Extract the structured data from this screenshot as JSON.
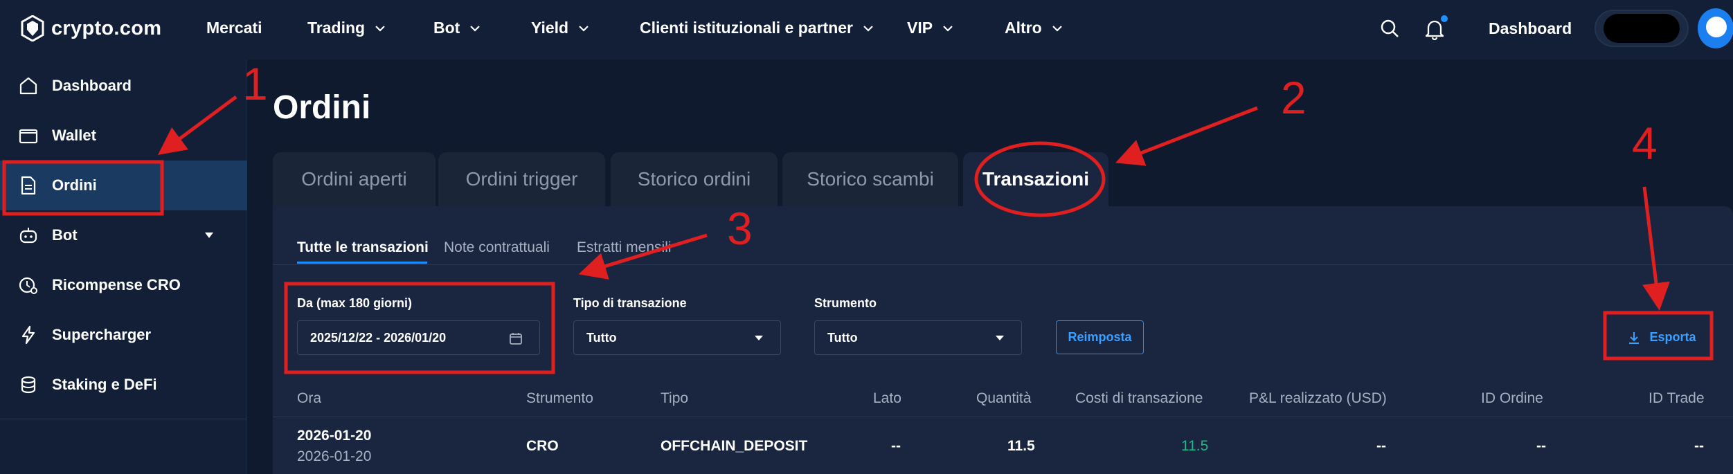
{
  "brand": {
    "name": "crypto.com"
  },
  "topnav": {
    "items": [
      {
        "label": "Mercati",
        "has_dropdown": false
      },
      {
        "label": "Trading",
        "has_dropdown": true
      },
      {
        "label": "Bot",
        "has_dropdown": true
      },
      {
        "label": "Yield",
        "has_dropdown": true
      },
      {
        "label": "Clienti istituzionali e partner",
        "has_dropdown": true
      },
      {
        "label": "VIP",
        "has_dropdown": true
      },
      {
        "label": "Altro",
        "has_dropdown": true
      }
    ],
    "icons": [
      "search-icon",
      "bell-icon"
    ],
    "dashboard_label": "Dashboard"
  },
  "sidebar": {
    "items": [
      {
        "label": "Dashboard",
        "icon": "home-icon"
      },
      {
        "label": "Wallet",
        "icon": "wallet-icon"
      },
      {
        "label": "Ordini",
        "icon": "document-icon",
        "active": true
      },
      {
        "label": "Bot",
        "icon": "robot-icon",
        "has_dropdown": true
      },
      {
        "label": "Ricompense CRO",
        "icon": "rewards-icon"
      },
      {
        "label": "Supercharger",
        "icon": "lightning-icon"
      },
      {
        "label": "Staking e DeFi",
        "icon": "coins-icon"
      }
    ]
  },
  "page": {
    "title": "Ordini"
  },
  "tabs": [
    {
      "label": "Ordini aperti"
    },
    {
      "label": "Ordini trigger"
    },
    {
      "label": "Storico ordini"
    },
    {
      "label": "Storico scambi"
    },
    {
      "label": "Transazioni",
      "active": true
    }
  ],
  "subtabs": [
    {
      "label": "Tutte le transazioni",
      "active": true
    },
    {
      "label": "Note contrattuali"
    },
    {
      "label": "Estratti mensili"
    }
  ],
  "filters": {
    "date_label": "Da (max 180 giorni)",
    "date_value": "2025/12/22 - 2026/01/20",
    "type_label": "Tipo di transazione",
    "type_value": "Tutto",
    "instrument_label": "Strumento",
    "instrument_value": "Tutto",
    "reset_label": "Reimposta",
    "export_label": "Esporta"
  },
  "table": {
    "headers": [
      "Ora",
      "Strumento",
      "Tipo",
      "Lato",
      "Quantità",
      "Costi di transazione",
      "P&L realizzato (USD)",
      "ID Ordine",
      "ID Trade"
    ],
    "rows": [
      {
        "time_1": "2026-01-20",
        "time_2": "2026-01-20",
        "instrument": "CRO",
        "type": "OFFCHAIN_DEPOSIT",
        "side": "--",
        "quantity": "11.5",
        "fee": "11.5",
        "pnl": "--",
        "order_id": "--",
        "trade_id": "--"
      }
    ]
  },
  "annotations": {
    "labels": [
      "1",
      "2",
      "3",
      "4"
    ],
    "color": "#e02020"
  },
  "colors": {
    "accent": "#1e90ff",
    "positive": "#1fb887",
    "annotation": "#e02020",
    "background": "#0f1a2e"
  }
}
